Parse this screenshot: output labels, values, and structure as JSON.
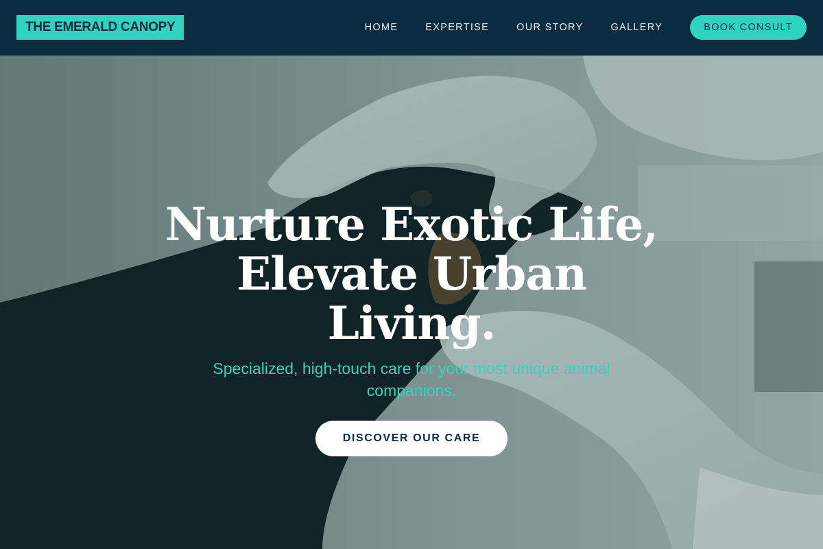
{
  "brand": {
    "logo_text": "THE EMERALD CANOPY"
  },
  "nav": {
    "items": [
      {
        "label": "HOME"
      },
      {
        "label": "EXPERTISE"
      },
      {
        "label": "OUR STORY"
      },
      {
        "label": "GALLERY"
      }
    ],
    "cta_label": "BOOK CONSULT"
  },
  "hero": {
    "title_line1": "Nurture Exotic Life,",
    "title_line2": "Elevate Urban Living.",
    "subtitle": "Specialized, high-touch care for your most unique animal companions.",
    "button_label": "DISCOVER OUR CARE",
    "image_subject": "veterinarian-gloved-hands-examining-black-dog"
  },
  "colors": {
    "header_bg": "#0b2c40",
    "accent": "#2fd3bf",
    "hero_text": "#ffffff",
    "subtitle_text": "#38d3bd"
  }
}
